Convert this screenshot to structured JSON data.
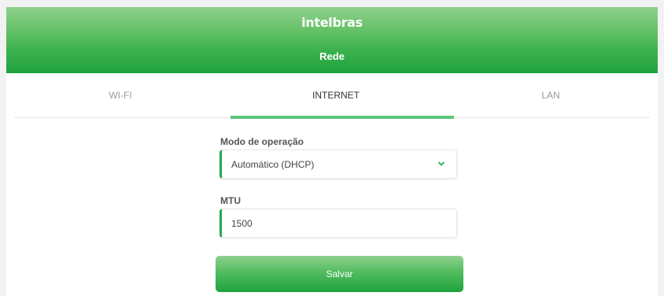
{
  "header": {
    "logo_text": "intelbras",
    "page_title": "Rede"
  },
  "tabs": [
    {
      "label": "WI-FI",
      "active": false
    },
    {
      "label": "INTERNET",
      "active": true
    },
    {
      "label": "LAN",
      "active": false
    }
  ],
  "form": {
    "mode": {
      "label": "Modo de operação",
      "value": "Automático (DHCP)"
    },
    "mtu": {
      "label": "MTU",
      "value": "1500"
    },
    "save_label": "Salvar"
  },
  "colors": {
    "brand_green": "#1ea23e",
    "tab_underline": "#5cc47a"
  },
  "icons": {
    "select_chevron": "chevron-down-icon"
  }
}
